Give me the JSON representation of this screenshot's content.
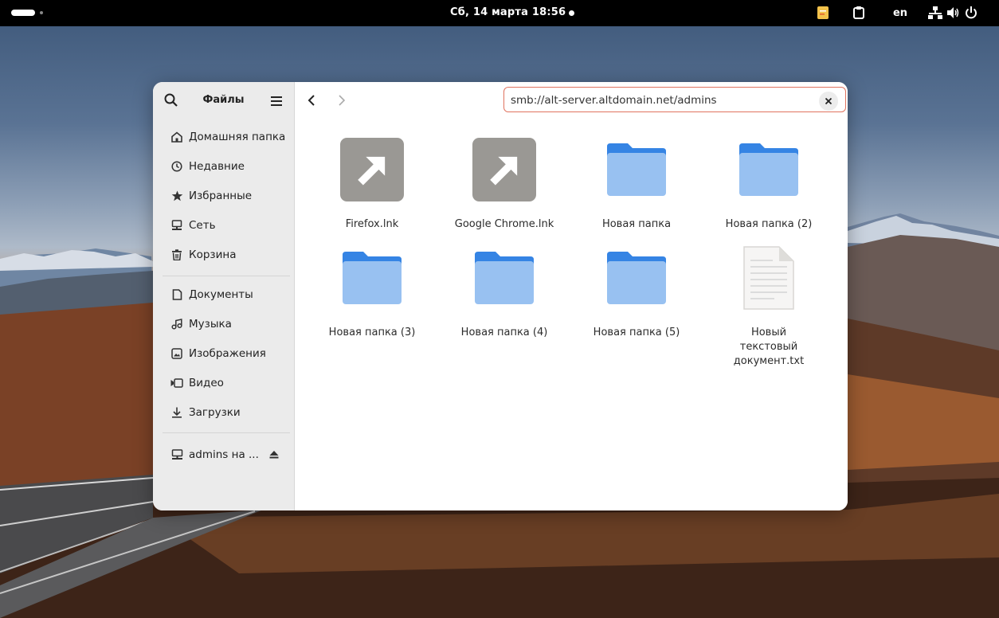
{
  "topbar": {
    "clock": "Сб, 14 марта  18:56",
    "lang": "en"
  },
  "window": {
    "app_title": "Файлы",
    "location": "smb://alt-server.altdomain.net/admins"
  },
  "sidebar": {
    "places": [
      {
        "label": "Домашняя папка",
        "icon": "home-icon"
      },
      {
        "label": "Недавние",
        "icon": "recent-clock-icon"
      },
      {
        "label": "Избранные",
        "icon": "star-icon"
      },
      {
        "label": "Сеть",
        "icon": "network-icon"
      },
      {
        "label": "Корзина",
        "icon": "trash-icon"
      }
    ],
    "bookmarks": [
      {
        "label": "Документы",
        "icon": "document-icon"
      },
      {
        "label": "Музыка",
        "icon": "music-icon"
      },
      {
        "label": "Изображения",
        "icon": "image-icon"
      },
      {
        "label": "Видео",
        "icon": "video-icon"
      },
      {
        "label": "Загрузки",
        "icon": "download-icon"
      }
    ],
    "mounts": [
      {
        "label": "admins на ...",
        "icon": "network-share-icon"
      }
    ]
  },
  "files": [
    {
      "name": "Firefox.lnk",
      "type": "link"
    },
    {
      "name": "Google Chrome.lnk",
      "type": "link"
    },
    {
      "name": "Новая папка",
      "type": "folder"
    },
    {
      "name": "Новая папка (2)",
      "type": "folder"
    },
    {
      "name": "Новая папка (3)",
      "type": "folder"
    },
    {
      "name": "Новая папка (4)",
      "type": "folder"
    },
    {
      "name": "Новая папка (5)",
      "type": "folder"
    },
    {
      "name": "Новый текстовый документ.txt",
      "type": "text"
    }
  ],
  "colors": {
    "folder_tab": "#3584e4",
    "folder_body": "#98c1f1",
    "focus_border": "#e0735f",
    "sidebar_bg": "#ebebeb"
  }
}
